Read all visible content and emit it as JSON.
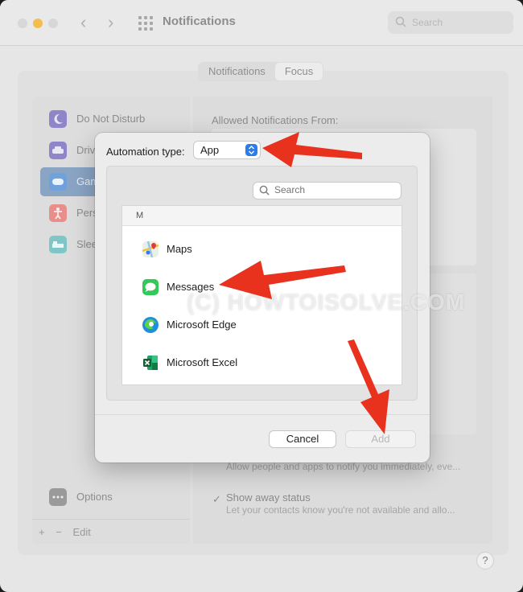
{
  "window": {
    "title": "Notifications",
    "search_placeholder": "Search"
  },
  "tabs": [
    {
      "label": "Notifications",
      "active": false
    },
    {
      "label": "Focus",
      "active": true
    }
  ],
  "sidebar": {
    "items": [
      {
        "label": "Do Not Disturb",
        "icon": "moon-icon",
        "color": "#8e86c8"
      },
      {
        "label": "Driv",
        "icon": "car-icon",
        "color": "#8e86c8"
      },
      {
        "label": "Gam",
        "icon": "gamepad-icon",
        "color": "#6fa1dc",
        "selected": true
      },
      {
        "label": "Pers",
        "icon": "person-icon",
        "color": "#e88f8b"
      },
      {
        "label": "Slee",
        "icon": "bed-icon",
        "color": "#7fc6c8"
      }
    ],
    "options_label": "Options",
    "add_symbol": "+",
    "remove_symbol": "−",
    "edit_label": "Edit"
  },
  "right_panel": {
    "allowed_title": "Allowed Notifications From:",
    "immediate_desc": "Allow people and apps to notify you immediately, eve...",
    "away_status_title": "Show away status",
    "away_status_desc": "Let your contacts know you're not available and allo...",
    "help_symbol": "?"
  },
  "dialog": {
    "automation_label": "Automation type:",
    "automation_value": "App",
    "search_placeholder": "Search",
    "section_header": "M",
    "apps": [
      {
        "name": "Maps",
        "icon": "maps-icon"
      },
      {
        "name": "Messages",
        "icon": "messages-icon"
      },
      {
        "name": "Microsoft Edge",
        "icon": "edge-icon"
      },
      {
        "name": "Microsoft Excel",
        "icon": "excel-icon"
      }
    ],
    "cancel_label": "Cancel",
    "add_label": "Add"
  },
  "watermark": "(C) HOWTOISOLVE.COM",
  "colors": {
    "accent_blue": "#2b7de9",
    "annotation_arrow": "#e8321e",
    "selected_sidebar": "#8aa4c4"
  }
}
